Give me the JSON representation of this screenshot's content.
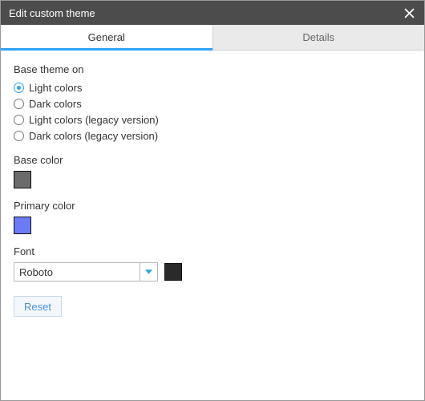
{
  "dialog": {
    "title": "Edit custom theme"
  },
  "tabs": {
    "general": "General",
    "details": "Details",
    "active": "general"
  },
  "baseTheme": {
    "label": "Base theme on",
    "options": [
      "Light colors",
      "Dark colors",
      "Light colors (legacy version)",
      "Dark colors (legacy version)"
    ],
    "selectedIndex": 0
  },
  "baseColor": {
    "label": "Base color",
    "value": "#6b6b6b"
  },
  "primaryColor": {
    "label": "Primary color",
    "value": "#6b7af5"
  },
  "font": {
    "label": "Font",
    "value": "Roboto",
    "colorValue": "#2a2a2a"
  },
  "buttons": {
    "reset": "Reset"
  }
}
